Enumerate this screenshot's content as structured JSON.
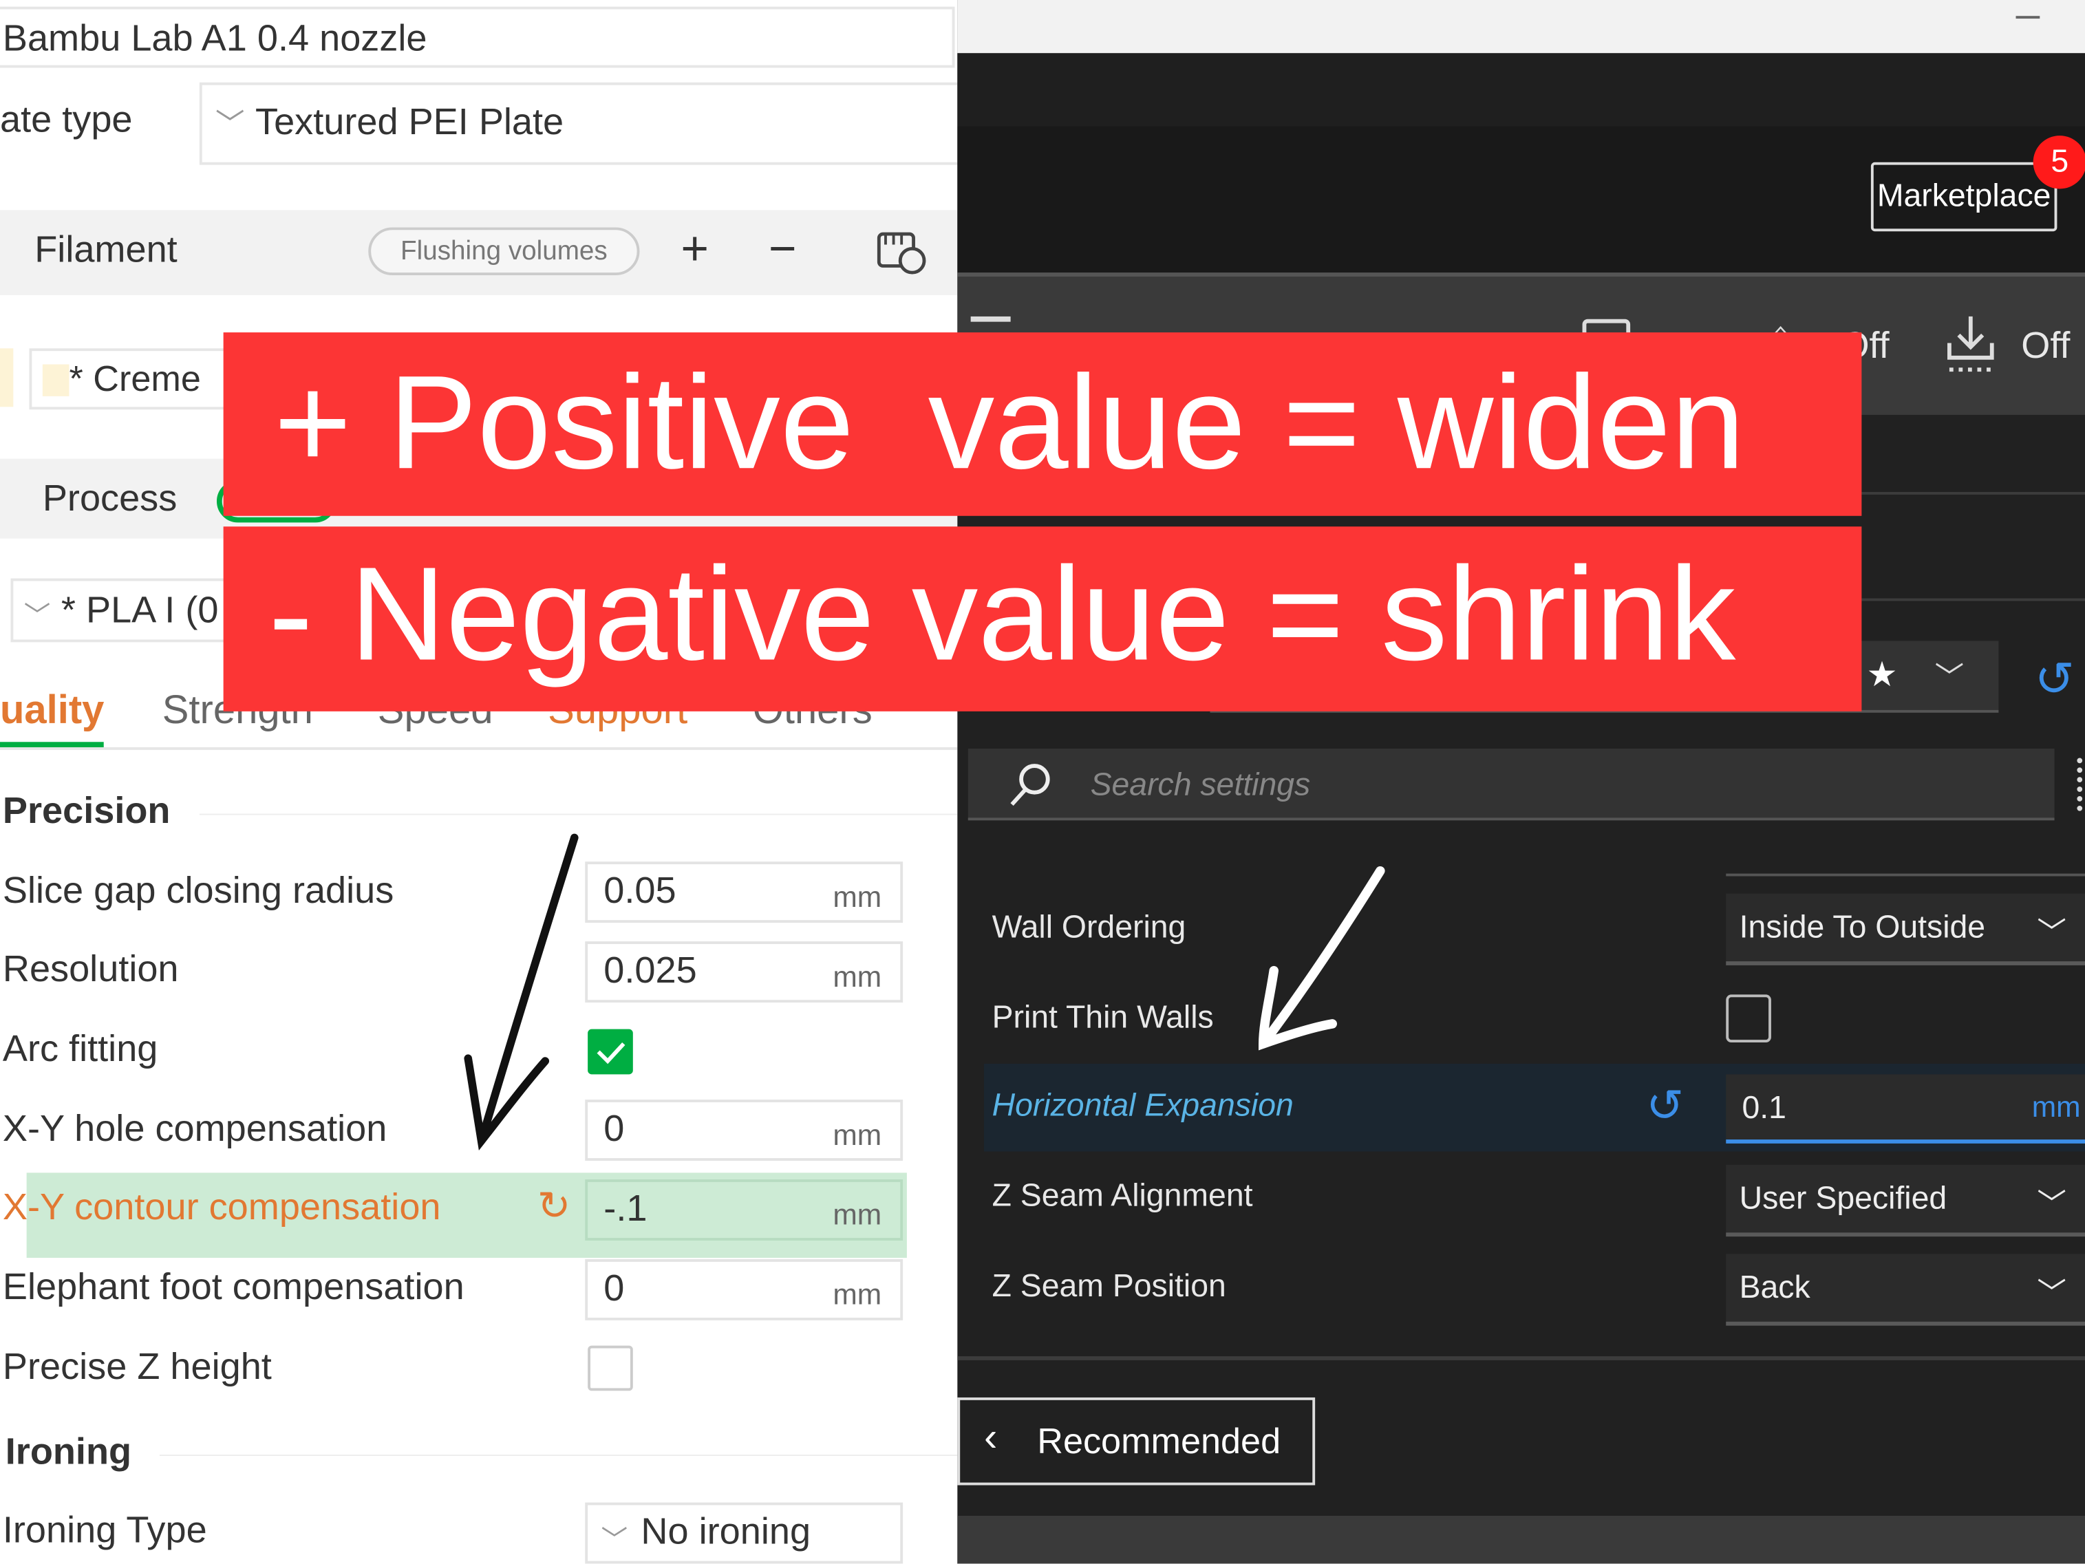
{
  "left_panel": {
    "printer": "Bambu Lab A1 0.4 nozzle",
    "plate_type_label": "ate type",
    "plate_type_value": "Textured PEI Plate",
    "filament_label": "Filament",
    "flushing_volumes": "Flushing volumes",
    "add": "+",
    "remove": "−",
    "filament_item": "* Creme",
    "process_label": "Process",
    "process_preset": "* PLA I (0",
    "tabs": [
      "uality",
      "Strength",
      "Speed",
      "Support",
      "Others"
    ],
    "sections": {
      "precision": "Precision",
      "ironing": "Ironing"
    },
    "rows": [
      {
        "label": "Slice gap closing radius",
        "value": "0.05",
        "unit": "mm"
      },
      {
        "label": "Resolution",
        "value": "0.025",
        "unit": "mm"
      },
      {
        "label": "Arc fitting",
        "checked": true
      },
      {
        "label": "X-Y hole compensation",
        "value": "0",
        "unit": "mm"
      },
      {
        "label": "X-Y contour compensation",
        "value": "-.1",
        "unit": "mm"
      },
      {
        "label": "Elephant foot compensation",
        "value": "0",
        "unit": "mm"
      },
      {
        "label": "Precise Z height",
        "checked": false
      },
      {
        "label": "Ironing Type",
        "value": "No ironing"
      }
    ]
  },
  "right_panel": {
    "marketplace": "Marketplace",
    "marketplace_badge": "5",
    "toolbar": {
      "support": "Off",
      "adhesion": "Off"
    },
    "search_placeholder": "Search settings",
    "settings": [
      {
        "label": "Wall Ordering",
        "value": "Inside To Outside"
      },
      {
        "label": "Print Thin Walls",
        "checked": false
      },
      {
        "label": "Horizontal Expansion",
        "value": "0.1",
        "unit": "mm"
      },
      {
        "label": "Z Seam Alignment",
        "value": "User Specified"
      },
      {
        "label": "Z Seam Position",
        "value": "Back"
      }
    ],
    "recommended": "Recommended"
  },
  "overlay": {
    "line1": "+ Positive  value = widen",
    "line2": "- Negative value = shrink"
  },
  "colors": {
    "banner": "#fc3535",
    "accent_green": "#00ae42",
    "accent_blue": "#3b8ee8",
    "badge": "#ff1a1a"
  }
}
